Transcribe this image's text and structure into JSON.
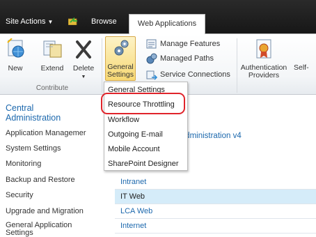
{
  "topbar": {
    "site_actions": "Site Actions",
    "tab_browse": "Browse",
    "tab_web_applications": "Web Applications"
  },
  "ribbon": {
    "contribute": {
      "group_label": "Contribute",
      "new": "New",
      "extend": "Extend",
      "delete": "Delete"
    },
    "general_settings_line1": "General",
    "general_settings_line2": "Settings",
    "manage_features": "Manage Features",
    "managed_paths": "Managed Paths",
    "service_connections": "Service Connections",
    "authentication_line1": "Authentication",
    "authentication_line2": "Providers",
    "self_partial": "Self-"
  },
  "dropdown": {
    "items": [
      "General Settings",
      "Resource Throttling",
      "Workflow",
      "Outgoing E-mail",
      "Mobile Account",
      "SharePoint Designer"
    ]
  },
  "leftnav": {
    "heading_line1": "Central",
    "heading_line2": "Administration",
    "items": [
      "Application Managemer",
      "System Settings",
      "Monitoring",
      "Backup and Restore",
      "Security",
      "Upgrade and Migration",
      "General Application",
      "Settings"
    ]
  },
  "main": {
    "header_link": "al Administration v4",
    "rows": [
      "Intranet",
      "IT Web",
      "LCA Web",
      "Internet"
    ]
  }
}
